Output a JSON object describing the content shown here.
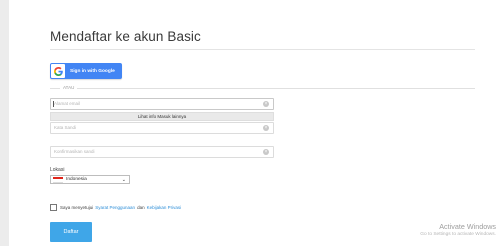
{
  "page": {
    "title": "Mendaftar ke akun Basic"
  },
  "google": {
    "label": "Sign in with Google",
    "icon": "google-g-icon"
  },
  "separator": {
    "label": "ATAU"
  },
  "fields": {
    "email_placeholder": "Alamat email",
    "password_placeholder": "Kata Sandi",
    "confirm_placeholder": "Konfirmasikan sandi",
    "clear_icon": "clear-icon"
  },
  "suggestion": {
    "label": "Lihat info Masuk lainnya"
  },
  "location": {
    "label": "Lokasi",
    "selected": "Indonesia",
    "flag_colors": [
      "#e0261b",
      "#ffffff"
    ]
  },
  "terms": {
    "prefix": "Saya menyetujui",
    "link1": "Syarat Penggunaan",
    "conjunction": "dan",
    "link2": "Kebijakan Privasi"
  },
  "submit": {
    "label": "Daftar",
    "color": "#3fa6e8"
  },
  "watermark": {
    "title": "Activate Windows",
    "subtitle": "Go to Settings to activate Windows."
  }
}
